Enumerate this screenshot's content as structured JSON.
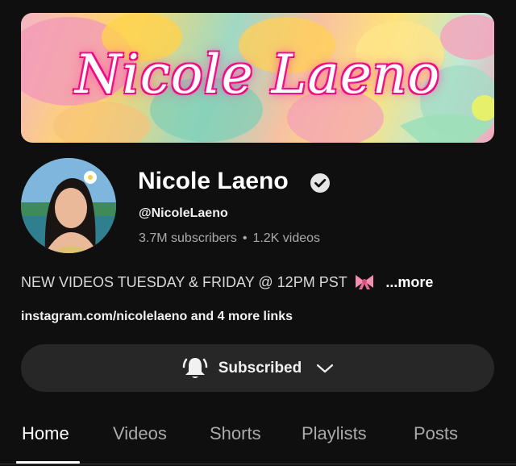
{
  "banner": {
    "title": "Nicole Laeno",
    "accent_color": "#ff2d9a"
  },
  "channel": {
    "name": "Nicole Laeno",
    "verified_icon": "verified-check-icon",
    "handle": "@NicoleLaeno",
    "subscribers": "3.7M subscribers",
    "separator": "•",
    "videos": "1.2K videos"
  },
  "description": {
    "text": "NEW VIDEOS TUESDAY & FRIDAY @ 12PM PST",
    "emoji_icon": "ribbon-bow-icon",
    "more_label": "...more"
  },
  "links": {
    "text": "instagram.com/nicolelaeno and 4 more links"
  },
  "subscribe": {
    "label": "Subscribed",
    "bell_icon": "bell-icon",
    "chevron_icon": "chevron-down-icon"
  },
  "tabs": [
    {
      "label": "Home",
      "active": true
    },
    {
      "label": "Videos",
      "active": false
    },
    {
      "label": "Shorts",
      "active": false
    },
    {
      "label": "Playlists",
      "active": false
    },
    {
      "label": "Posts",
      "active": false
    }
  ]
}
